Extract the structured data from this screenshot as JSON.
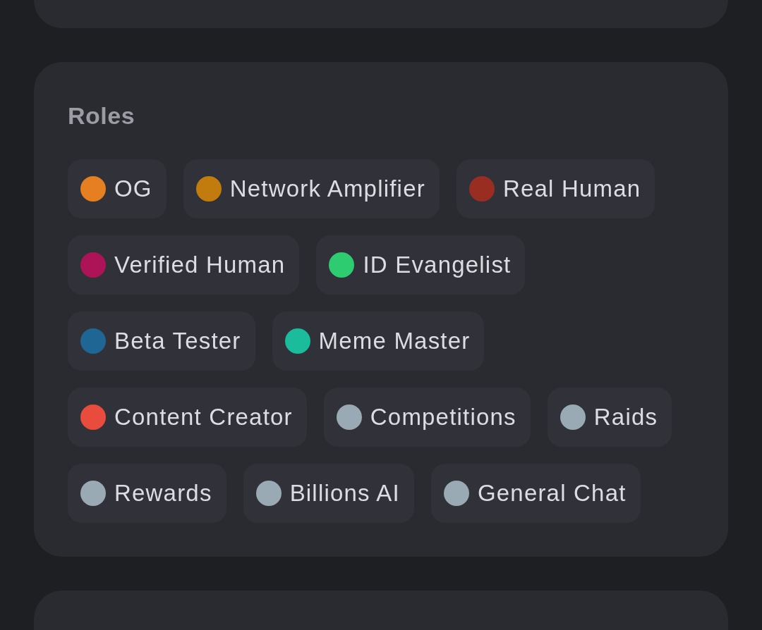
{
  "roles_card": {
    "title": "Roles",
    "roles": [
      {
        "name": "OG",
        "color": "#e67e22"
      },
      {
        "name": "Network Amplifier",
        "color": "#c27c0e"
      },
      {
        "name": "Real Human",
        "color": "#992d22"
      },
      {
        "name": "Verified Human",
        "color": "#ad1457"
      },
      {
        "name": "ID Evangelist",
        "color": "#2ecc71"
      },
      {
        "name": "Beta Tester",
        "color": "#206694"
      },
      {
        "name": "Meme Master",
        "color": "#1abc9c"
      },
      {
        "name": "Content Creator",
        "color": "#e74c3c"
      },
      {
        "name": "Competitions",
        "color": "#99aab5"
      },
      {
        "name": "Raids",
        "color": "#99aab5"
      },
      {
        "name": "Rewards",
        "color": "#99aab5"
      },
      {
        "name": "Billions AI",
        "color": "#99aab5"
      },
      {
        "name": "General Chat",
        "color": "#99aab5"
      }
    ]
  }
}
